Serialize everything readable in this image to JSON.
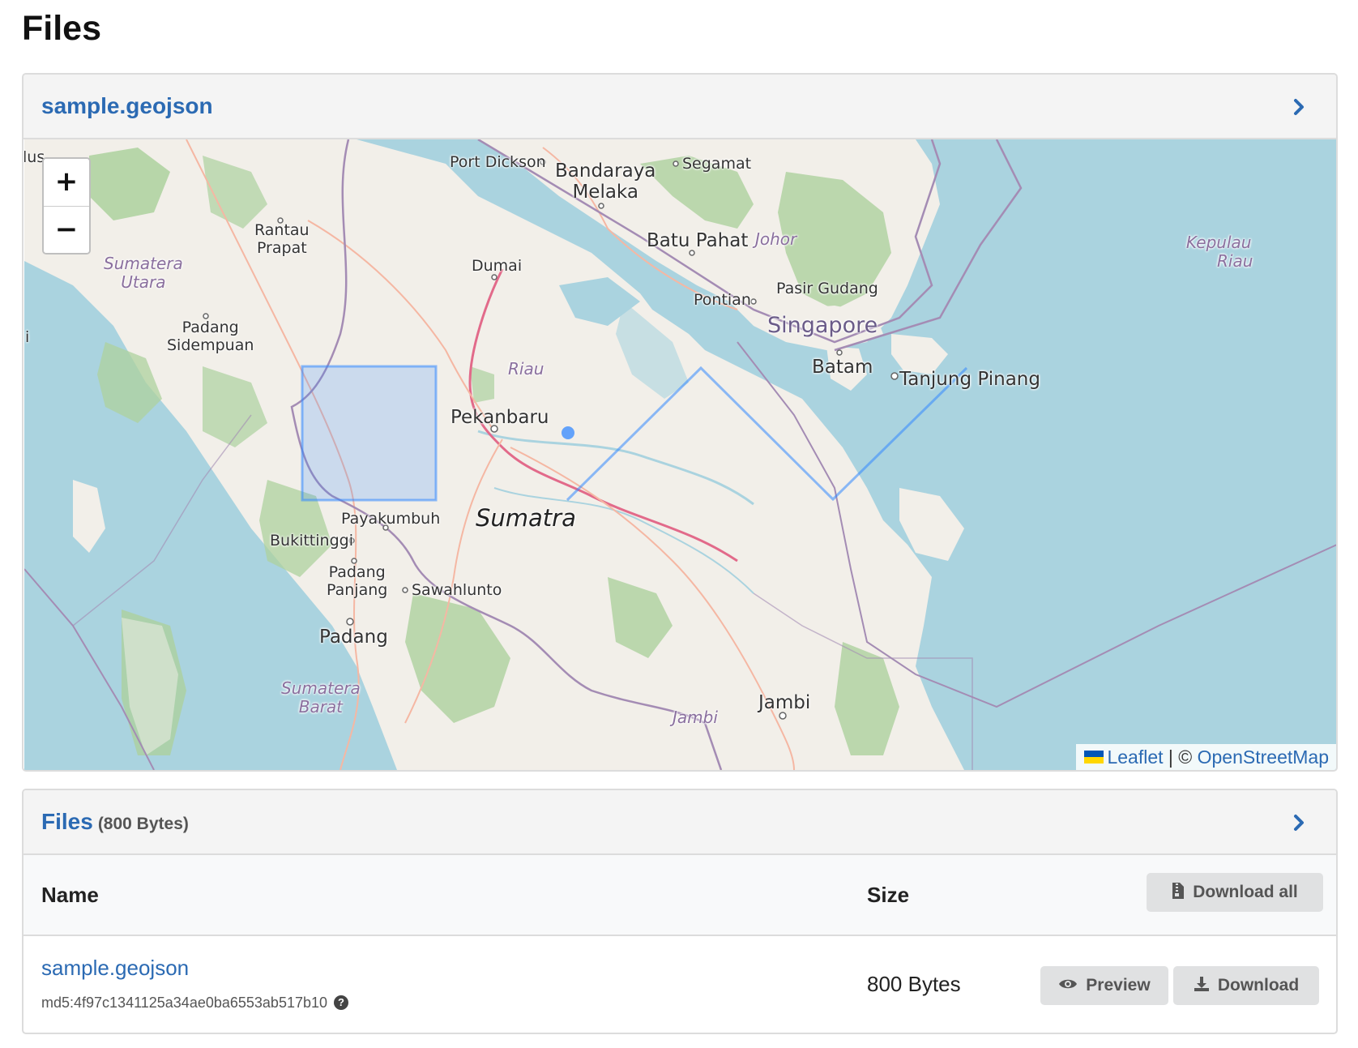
{
  "page": {
    "title": "Files"
  },
  "preview_panel": {
    "title": "sample.geojson",
    "map": {
      "zoom_in": "+",
      "zoom_out": "−",
      "attribution": {
        "leaflet": "Leaflet",
        "separator": "|",
        "copyright": "©",
        "osm": "OpenStreetMap"
      },
      "labels": {
        "port_dickson": "Port Dickson",
        "bandaraya": "Bandaraya",
        "melaka": "Melaka",
        "segamat": "Segamat",
        "rantau": "Rantau",
        "prapat": "Prapat",
        "dumai": "Dumai",
        "batu_pahat": "Batu Pahat",
        "johor": "Johor",
        "kepulau": "Kepulau",
        "riau_kep": "Riau",
        "sumatera_utara_1": "Sumatera",
        "sumatera_utara_2": "Utara",
        "pontian": "Pontian",
        "pasir_gudang": "Pasir Gudang",
        "singapore": "Singapore",
        "padang_sid_1": "Padang",
        "padang_sid_2": "Sidempuan",
        "riau": "Riau",
        "batam": "Batam",
        "tanjung_pinang": "Tanjung Pinang",
        "pekanbaru": "Pekanbaru",
        "sumatra": "Sumatra",
        "payakumbuh": "Payakumbuh",
        "bukittinggi": "Bukittinggi",
        "padang_panjang_1": "Padang",
        "padang_panjang_2": "Panjang",
        "sawahlunto": "Sawahlunto",
        "padang": "Padang",
        "sumatera_barat_1": "Sumatera",
        "sumatera_barat_2": "Barat",
        "jambi": "Jambi",
        "jambi_region": "Jambi",
        "edge_left": "lus",
        "edge_left2": "i"
      }
    }
  },
  "files_panel": {
    "title": "Files",
    "total_size": "(800 Bytes)",
    "columns": {
      "name": "Name",
      "size": "Size"
    },
    "download_all_label": "Download all",
    "files": [
      {
        "name": "sample.geojson",
        "checksum": "md5:4f97c1341125a34ae0ba6553ab517b10",
        "size": "800 Bytes",
        "preview_label": "Preview",
        "download_label": "Download"
      }
    ]
  },
  "colors": {
    "link": "#2b6ab3",
    "water": "#aad3df",
    "land": "#f2efe9",
    "forest": "#add19e",
    "geometry": "#3388ff",
    "button_bg": "#e0e1e2"
  },
  "icons": {
    "header_chevron": "chevron-right-icon",
    "download_all": "file-archive-icon",
    "preview": "eye-icon",
    "download": "download-icon",
    "help": "question-circle-icon"
  }
}
